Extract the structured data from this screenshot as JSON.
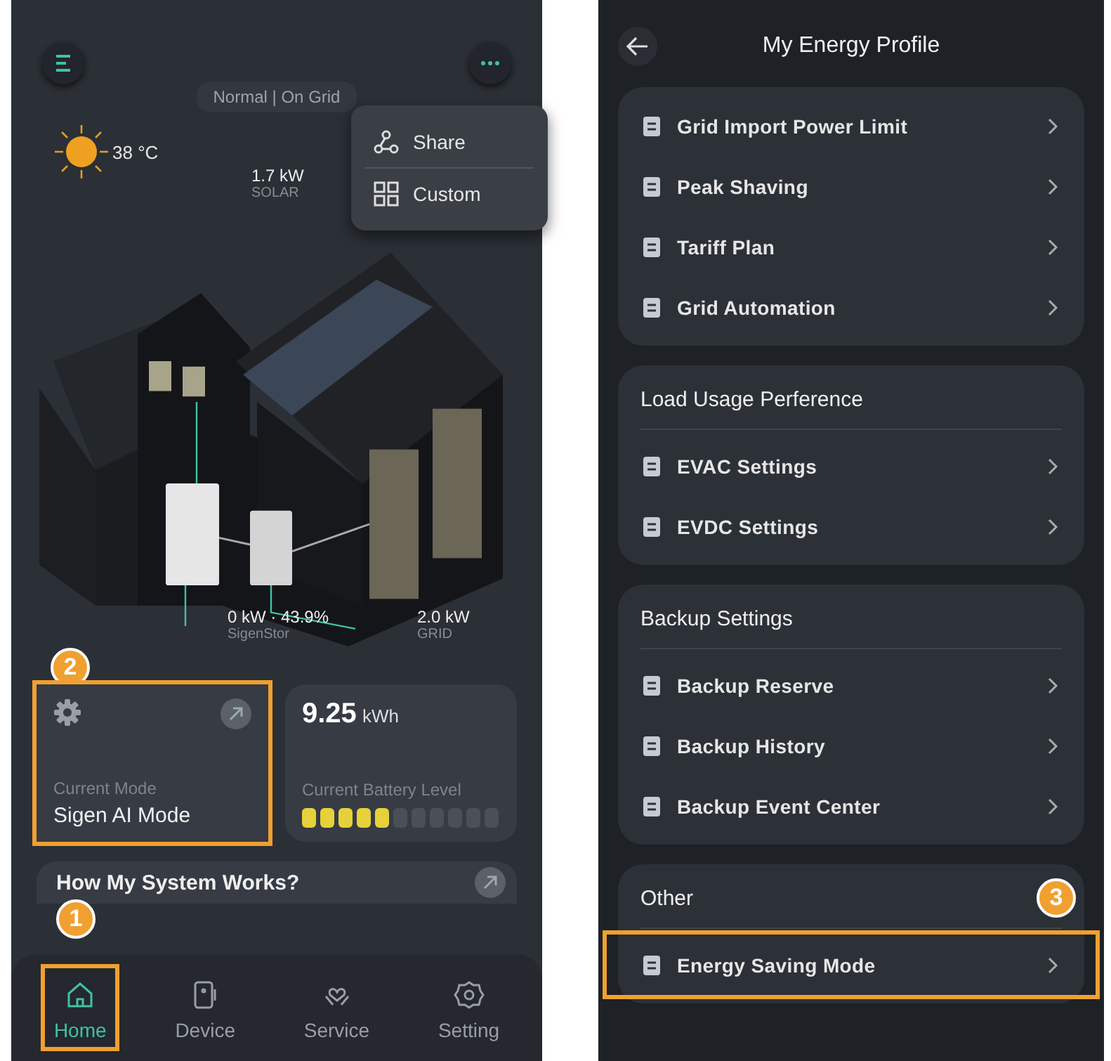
{
  "home_screen": {
    "status": "Normal | On Grid",
    "more_menu": [
      {
        "label": "Share"
      },
      {
        "label": "Custom"
      }
    ],
    "weather": {
      "temperature": "38 °C"
    },
    "flows": [
      {
        "kind": "solar",
        "value": "1.7 kW",
        "label": "SOLAR"
      },
      {
        "kind": "battery",
        "value": "0 kW · 43.9%",
        "label": "SigenStor"
      },
      {
        "kind": "grid",
        "value": "2.0 kW",
        "label": "GRID"
      }
    ],
    "mode_card": {
      "label": "Current Mode",
      "value": "Sigen AI Mode",
      "highlighted": true,
      "callout": "2"
    },
    "battery_card": {
      "energy": "9.25",
      "unit": "kWh",
      "label": "Current Battery Level",
      "level": 0.45
    },
    "how_card": {
      "title": "How My System Works?"
    },
    "nav": [
      {
        "label": "Home",
        "selected": true,
        "highlighted": true,
        "callout": "1"
      },
      {
        "label": "Device",
        "selected": false,
        "highlighted": false
      },
      {
        "label": "Service",
        "selected": false,
        "highlighted": false
      },
      {
        "label": "Setting",
        "selected": false,
        "highlighted": false
      }
    ]
  },
  "profile_screen": {
    "title": "My Energy Profile",
    "groups": [
      {
        "items": [
          {
            "label": "Grid Import Power Limit",
            "highlighted": false
          },
          {
            "label": "Peak Shaving",
            "highlighted": false
          },
          {
            "label": "Tariff Plan",
            "highlighted": false
          },
          {
            "label": "Grid Automation",
            "highlighted": false
          }
        ]
      },
      {
        "title": "Load Usage Perference",
        "items": [
          {
            "label": "EVAC Settings",
            "highlighted": false
          },
          {
            "label": "EVDC Settings",
            "highlighted": false
          }
        ]
      },
      {
        "title": "Backup Settings",
        "items": [
          {
            "label": "Backup Reserve",
            "highlighted": false
          },
          {
            "label": "Backup History",
            "highlighted": false
          },
          {
            "label": "Backup Event Center",
            "highlighted": false
          }
        ]
      },
      {
        "title": "Other",
        "callout": "3",
        "items": [
          {
            "label": "Energy Saving Mode",
            "highlighted": true
          }
        ]
      }
    ]
  }
}
